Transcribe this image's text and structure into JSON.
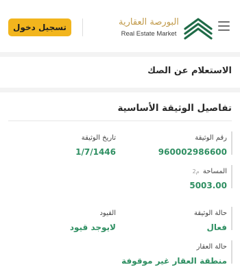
{
  "header": {
    "login_label": "تسجيل دخول",
    "brand_arabic": "البورصة العقارية",
    "brand_english": "Real Estate Market"
  },
  "inquiry": {
    "title": "الاستعلام عن الصك"
  },
  "details": {
    "title": "تفاصيل الوثيقة الأساسية",
    "fields": [
      {
        "label": "رقم الوثيقة",
        "value": "960002986600"
      },
      {
        "label": "تاريخ الوثيقة",
        "value": "1/7/1446"
      },
      {
        "label": "المساحة",
        "unit": "م2",
        "value": "5003.00"
      },
      {
        "label": "حالة الوثيقة",
        "value": "فعال"
      },
      {
        "label": "القيود",
        "value": "لايوجد قيود"
      },
      {
        "label": "حالة العقار",
        "value": "منطقة العقار غير موقوفة"
      }
    ]
  },
  "colors": {
    "accent": "#f2b51d",
    "value_green": "#2f8f62",
    "brand_gold": "#c19a4a",
    "logo_green": "#1f6b47"
  }
}
